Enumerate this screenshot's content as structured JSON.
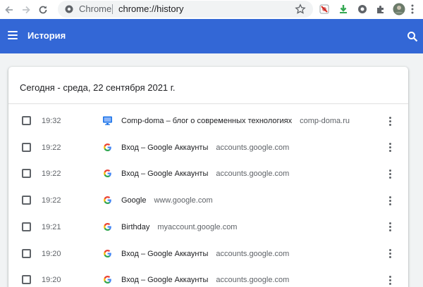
{
  "browser": {
    "omnibox_label": "Chrome",
    "url": "chrome://history"
  },
  "header": {
    "title": "История"
  },
  "history": {
    "date_heading": "Сегодня - среда, 22 сентября 2021 г.",
    "entries": [
      {
        "time": "19:32",
        "title": "Comp-doma – блог о современных технологиях",
        "domain": "comp-doma.ru",
        "favicon": "monitor-icon"
      },
      {
        "time": "19:22",
        "title": "Вход – Google Аккаунты",
        "domain": "accounts.google.com",
        "favicon": "google-g-icon"
      },
      {
        "time": "19:22",
        "title": "Вход – Google Аккаунты",
        "domain": "accounts.google.com",
        "favicon": "google-g-icon"
      },
      {
        "time": "19:22",
        "title": "Google",
        "domain": "www.google.com",
        "favicon": "google-g-icon"
      },
      {
        "time": "19:21",
        "title": "Birthday",
        "domain": "myaccount.google.com",
        "favicon": "google-g-icon"
      },
      {
        "time": "19:20",
        "title": "Вход – Google Аккаунты",
        "domain": "accounts.google.com",
        "favicon": "google-g-icon"
      },
      {
        "time": "19:20",
        "title": "Вход – Google Аккаунты",
        "domain": "accounts.google.com",
        "favicon": "google-g-icon"
      }
    ]
  },
  "colors": {
    "appbar": "#3367d6",
    "background": "#f1f3f4",
    "text_primary": "#202124",
    "text_secondary": "#5f6368"
  }
}
